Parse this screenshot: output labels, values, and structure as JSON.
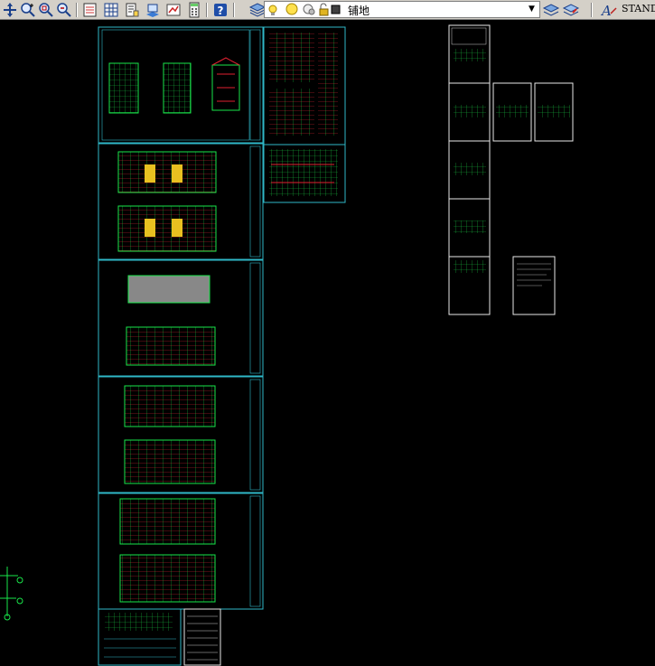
{
  "toolbar": {
    "layer_name": "铺地",
    "text_style": "STANDA",
    "colors": {
      "toolbar_bg": "#d4d0c8",
      "sheet_border": "#2fb8c8",
      "drawing_green": "#19e64a",
      "drawing_red": "#e02030",
      "canvas_bg": "#000000"
    }
  },
  "icons": [
    "pan-icon",
    "zoom-realtime-icon",
    "zoom-window-icon",
    "zoom-previous-icon",
    "properties-icon",
    "design-center-icon",
    "tool-palettes-icon",
    "sheet-set-icon",
    "quickcalc-icon",
    "help-icon",
    "layer-manager-icon",
    "layer-on-icon",
    "layer-freeze-icon",
    "layer-lock-icon",
    "layer-color-icon",
    "layer-previous-icon",
    "layer-state-icon",
    "text-style-icon"
  ]
}
